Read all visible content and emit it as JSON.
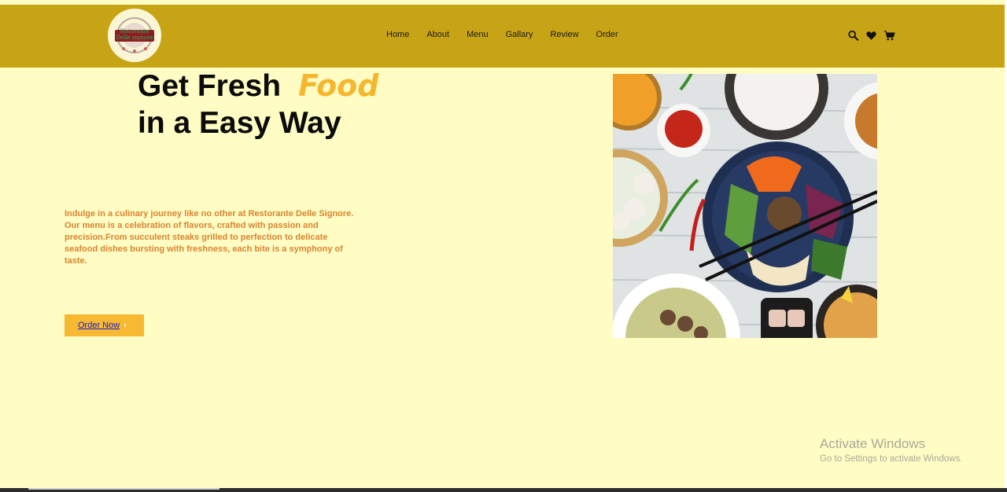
{
  "brand": {
    "logo_text_line1": "Ristorante",
    "logo_text_line2": "Delle signore"
  },
  "nav": {
    "links": [
      {
        "label": "Home"
      },
      {
        "label": "About"
      },
      {
        "label": "Menu"
      },
      {
        "label": "Gallary"
      },
      {
        "label": "Review"
      },
      {
        "label": "Order"
      }
    ],
    "icons": [
      "search-icon",
      "heart-icon",
      "cart-icon"
    ]
  },
  "hero": {
    "title_line1": "Get Fresh",
    "title_highlight": "Food",
    "title_line2": "in a Easy Way",
    "description": "Indulge in a culinary journey like no other at Restorante Delle Signore. Our menu is a celebration of flavors, crafted with passion and precision.From succulent steaks grilled to perfection to delicate seafood dishes bursting with freshness, each bite is a symphony of taste.",
    "cta_label": "Order Now",
    "cta_icon": "chevron-right-icon"
  },
  "watermark": {
    "title": "Activate Windows",
    "subtitle": "Go to Settings to activate Windows."
  },
  "colors": {
    "page_bg": "#fffdc4",
    "navbar_bg": "#c7a416",
    "accent": "#f5b72d",
    "button_bg": "#f6b931",
    "description_text": "#d9832f"
  }
}
